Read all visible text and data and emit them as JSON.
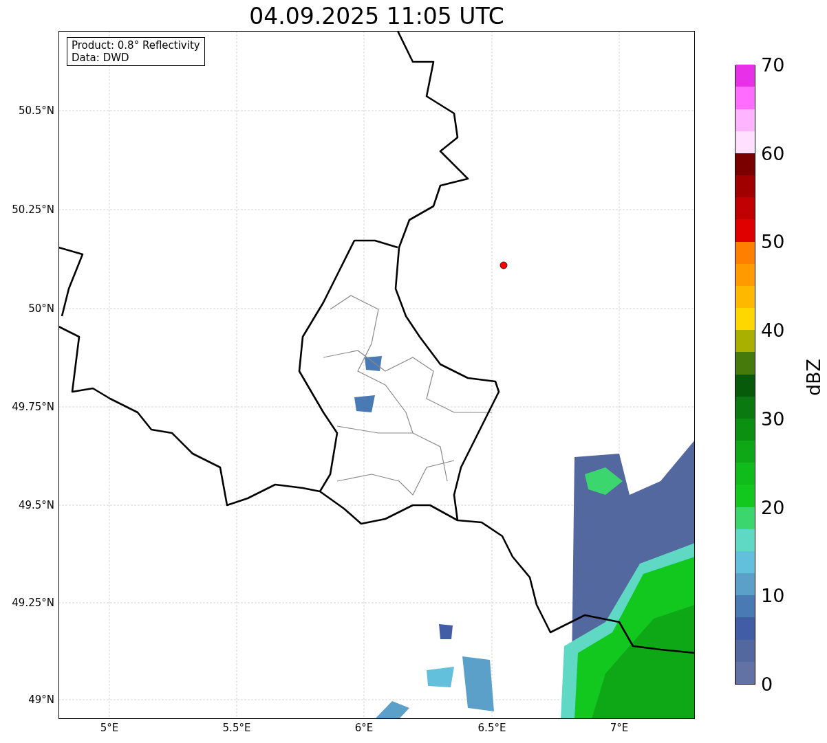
{
  "title": "04.09.2025 11:05 UTC",
  "info_box": [
    "Product: 0.8° Reflectivity",
    "Data: DWD"
  ],
  "map": {
    "lat_ticks": [
      "50.5°N",
      "50.25°N",
      "50°N",
      "49.75°N",
      "49.5°N",
      "49.25°N",
      "49°N"
    ],
    "lon_ticks": [
      "5°E",
      "5.5°E",
      "6°E",
      "6.5°E",
      "7°E"
    ]
  },
  "colorbar": {
    "label": "dBZ",
    "ticks": [
      "70",
      "60",
      "50",
      "40",
      "30",
      "20",
      "10",
      "0"
    ],
    "bands": [
      {
        "color": "#6272a4"
      },
      {
        "color": "#5468a0"
      },
      {
        "color": "#415da5"
      },
      {
        "color": "#4a7ab4"
      },
      {
        "color": "#5aa0c8"
      },
      {
        "color": "#63c0dc"
      },
      {
        "color": "#5fd8c4"
      },
      {
        "color": "#3cd66e"
      },
      {
        "color": "#12c81e"
      },
      {
        "color": "#10bb1c"
      },
      {
        "color": "#0ea816"
      },
      {
        "color": "#0b9012"
      },
      {
        "color": "#0a7a10"
      },
      {
        "color": "#075a0a"
      },
      {
        "color": "#467a0a"
      },
      {
        "color": "#aab000"
      },
      {
        "color": "#ffd700"
      },
      {
        "color": "#ffb800"
      },
      {
        "color": "#ff9a00"
      },
      {
        "color": "#ff7f00"
      },
      {
        "color": "#e00000"
      },
      {
        "color": "#c00000"
      },
      {
        "color": "#a00000"
      },
      {
        "color": "#7a0000"
      },
      {
        "color": "#ffe0ff"
      },
      {
        "color": "#ffb4ff"
      },
      {
        "color": "#ff6cff"
      },
      {
        "color": "#e930e9"
      }
    ]
  }
}
